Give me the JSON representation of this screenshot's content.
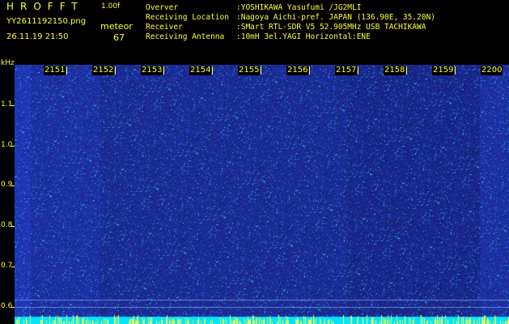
{
  "header": {
    "app_title": "HROFFT",
    "app_version": "1.00f",
    "file_name": "YY2611192150.png",
    "mode_label": "meteor",
    "datetime": "26.11.19 21:50",
    "count": "67"
  },
  "info": [
    {
      "label": "Overver",
      "value": ":YOSHIKAWA Yasufumi /JG2MLI"
    },
    {
      "label": "Receiving Location",
      "value": ":Nagoya Aichi-pref. JAPAN (136.90E, 35.20N)"
    },
    {
      "label": "Receiver",
      "value": ":SMart RTL-SDR V5 52.905MHz USB TACHIKAWA"
    },
    {
      "label": "Receiving Antenna",
      "value": ":10mH 3el.YAGI Horizontal:ENE"
    }
  ],
  "axis": {
    "y_unit": "kHz",
    "y_labels": [
      "1.1",
      "1.0",
      "0.9",
      "0.8",
      "0.7",
      "0.6"
    ],
    "x_labels": [
      "2151",
      "2152",
      "2153",
      "2154",
      "2155",
      "2156",
      "2157",
      "2158",
      "2159",
      "2200"
    ]
  },
  "colors": {
    "text": "#ffff33",
    "background": "#000000",
    "spectrum_base": "#1a2a9a",
    "spectrum_peak": "#00e5ff"
  }
}
